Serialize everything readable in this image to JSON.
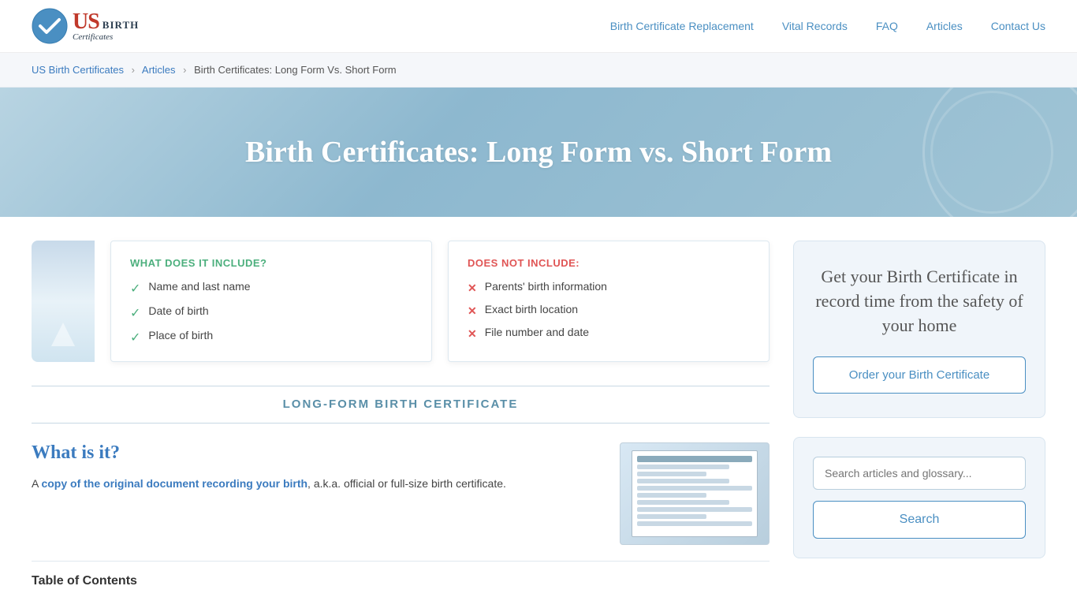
{
  "header": {
    "logo": {
      "text_us": "US",
      "text_birth": "BIRTH",
      "text_certificates": "Certificates"
    },
    "nav": {
      "items": [
        {
          "label": "Birth Certificate Replacement",
          "href": "#"
        },
        {
          "label": "Vital Records",
          "href": "#"
        },
        {
          "label": "FAQ",
          "href": "#"
        },
        {
          "label": "Articles",
          "href": "#"
        },
        {
          "label": "Contact Us",
          "href": "#"
        }
      ]
    }
  },
  "breadcrumb": {
    "home_label": "US Birth Certificates",
    "articles_label": "Articles",
    "current": "Birth Certificates: Long Form Vs. Short Form"
  },
  "hero": {
    "title": "Birth Certificates: Long Form vs. Short Form"
  },
  "comparison": {
    "includes_title": "WHAT DOES IT INCLUDE?",
    "includes_items": [
      "Name and last name",
      "Date of birth",
      "Place of birth"
    ],
    "excludes_title": "DOES NOT INCLUDE:",
    "excludes_items": [
      "Parents' birth information",
      "Exact birth location",
      "File number and date"
    ]
  },
  "long_form_section": {
    "section_title": "LONG-FORM BIRTH CERTIFICATE",
    "what_is_it_heading": "What is it?",
    "description_prefix": "A ",
    "description_bold": "copy of the original document recording your birth",
    "description_suffix": ", a.k.a. official or full-size birth certificate."
  },
  "toc": {
    "title": "Table of Contents"
  },
  "sidebar": {
    "cta_text": "Get your Birth Certificate in record time from the safety of your home",
    "order_button_label": "Order your Birth Certificate",
    "search_placeholder": "Search articles and glossary...",
    "search_button_label": "Search"
  }
}
